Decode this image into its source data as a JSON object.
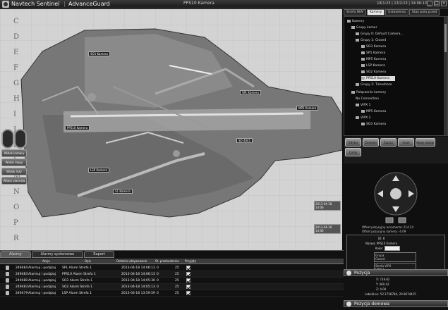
{
  "titlebar": {
    "app_name": "Navtech Sentinel",
    "module": "AdvanceGuard",
    "center_title": "PPS10 Kamera",
    "clock": "18/1:23 | 13/2:13 | 14:06:13"
  },
  "map": {
    "row_labels": [
      "C",
      "D",
      "E",
      "F",
      "G",
      "H",
      "I",
      "J",
      "K",
      "L",
      "M",
      "N",
      "O",
      "P",
      "R"
    ],
    "tags": [
      "SO1 Kamera",
      "PPS10 Kamera",
      "SO 4041",
      "MP5 Kamera",
      "SPL Kamera",
      "LSP Kamera",
      "S1 Kamera"
    ],
    "controls": [
      "Widok kamery",
      "Widok mapy",
      "Widok listy",
      "Widok alarmów"
    ],
    "timestamps": [
      "2013-04-18 14:06",
      "2013-04-18 14:06"
    ]
  },
  "right_panel": {
    "tabs": [
      "Strefa WW",
      "Kamery",
      "Ustawienia",
      "Stan pola przed"
    ],
    "tree": [
      {
        "label": "Kamery",
        "level": 0
      },
      {
        "label": "Grupy kamer",
        "level": 1
      },
      {
        "label": "Grupy 0: Default Camera...",
        "level": 2
      },
      {
        "label": "Grupy 1: Closed",
        "level": 2
      },
      {
        "label": "SO3 Kamera",
        "level": 3
      },
      {
        "label": "SP1 Kamera",
        "level": 3
      },
      {
        "label": "MP5 Kamera",
        "level": 3
      },
      {
        "label": "LSP Kamera",
        "level": 3
      },
      {
        "label": "SO2 Kamera",
        "level": 3
      },
      {
        "label": "PPS10 Kamera",
        "level": 3,
        "selected": true
      },
      {
        "label": "Grupy 2: Timeshare",
        "level": 2
      },
      {
        "label": "Połączenie kamery",
        "level": 1
      },
      {
        "label": "No Connection",
        "level": 2
      },
      {
        "label": "VIPX 1",
        "level": 2
      },
      {
        "label": "MP5 Kamera",
        "level": 3
      },
      {
        "label": "VIPX 2",
        "level": 2
      },
      {
        "label": "SO3 Kamera",
        "level": 3
      }
    ],
    "actions": [
      "Edytuj",
      "Zamknij",
      "Zapisz",
      "Usuń",
      "Nowy obszar",
      "Cofnij"
    ],
    "offsets": [
      "Offset pozycyjny w kamerze: 214.24",
      "Offset pozycyjny kamery: -4.09"
    ],
    "details": {
      "id_label": "ID: 6",
      "name_label": "Nazwa: PPS10 Kamera",
      "color_label": "Kolor:",
      "group_label": "Grupa",
      "group_value": "Closed",
      "stream_label": "Strefa VIPX",
      "stream_value": "VIPX 1"
    },
    "section_position": "Pozycja",
    "position": [
      "X: 728.82",
      "Y: 460.42",
      "Z: 4.00",
      "Label/Lon: 52.1758784, 20.9674415"
    ],
    "section_home": "Pozycja domowa"
  },
  "bottom": {
    "tabs": [
      "Alarmy",
      "Alarmy systemowe",
      "Raport"
    ],
    "columns": [
      "Akcja",
      "Opis",
      "Ostatnio aktywowane",
      "St. przebudzenia",
      "Przyjęty"
    ],
    "rows": [
      {
        "id": "249484",
        "action": "Alarmuj i podążaj",
        "desc": "SPL Alarm Strefa 1",
        "time": "2013-04-18 14:06:13",
        "count": "0",
        "flag": "25"
      },
      {
        "id": "249483",
        "action": "Alarmuj i podążaj",
        "desc": "PPS10 Alarm Strefa 1",
        "time": "2013-04-18 14:06:13",
        "count": "0",
        "flag": "25"
      },
      {
        "id": "249480",
        "action": "Alarmuj i podążaj",
        "desc": "SO3 Alarm Strefa 1",
        "time": "2013-04-18 14:05:30",
        "count": "0",
        "flag": "25"
      },
      {
        "id": "249483",
        "action": "Alarmuj i podążaj",
        "desc": "SO2 Alarm Strefa 1",
        "time": "2013-04-18 14:05:13",
        "count": "0",
        "flag": "25"
      },
      {
        "id": "249479",
        "action": "Alarmuj i podążaj",
        "desc": "LSP Alarm Strefa 1",
        "time": "2013-04-18 13:59:59",
        "count": "0",
        "flag": "25"
      }
    ]
  }
}
